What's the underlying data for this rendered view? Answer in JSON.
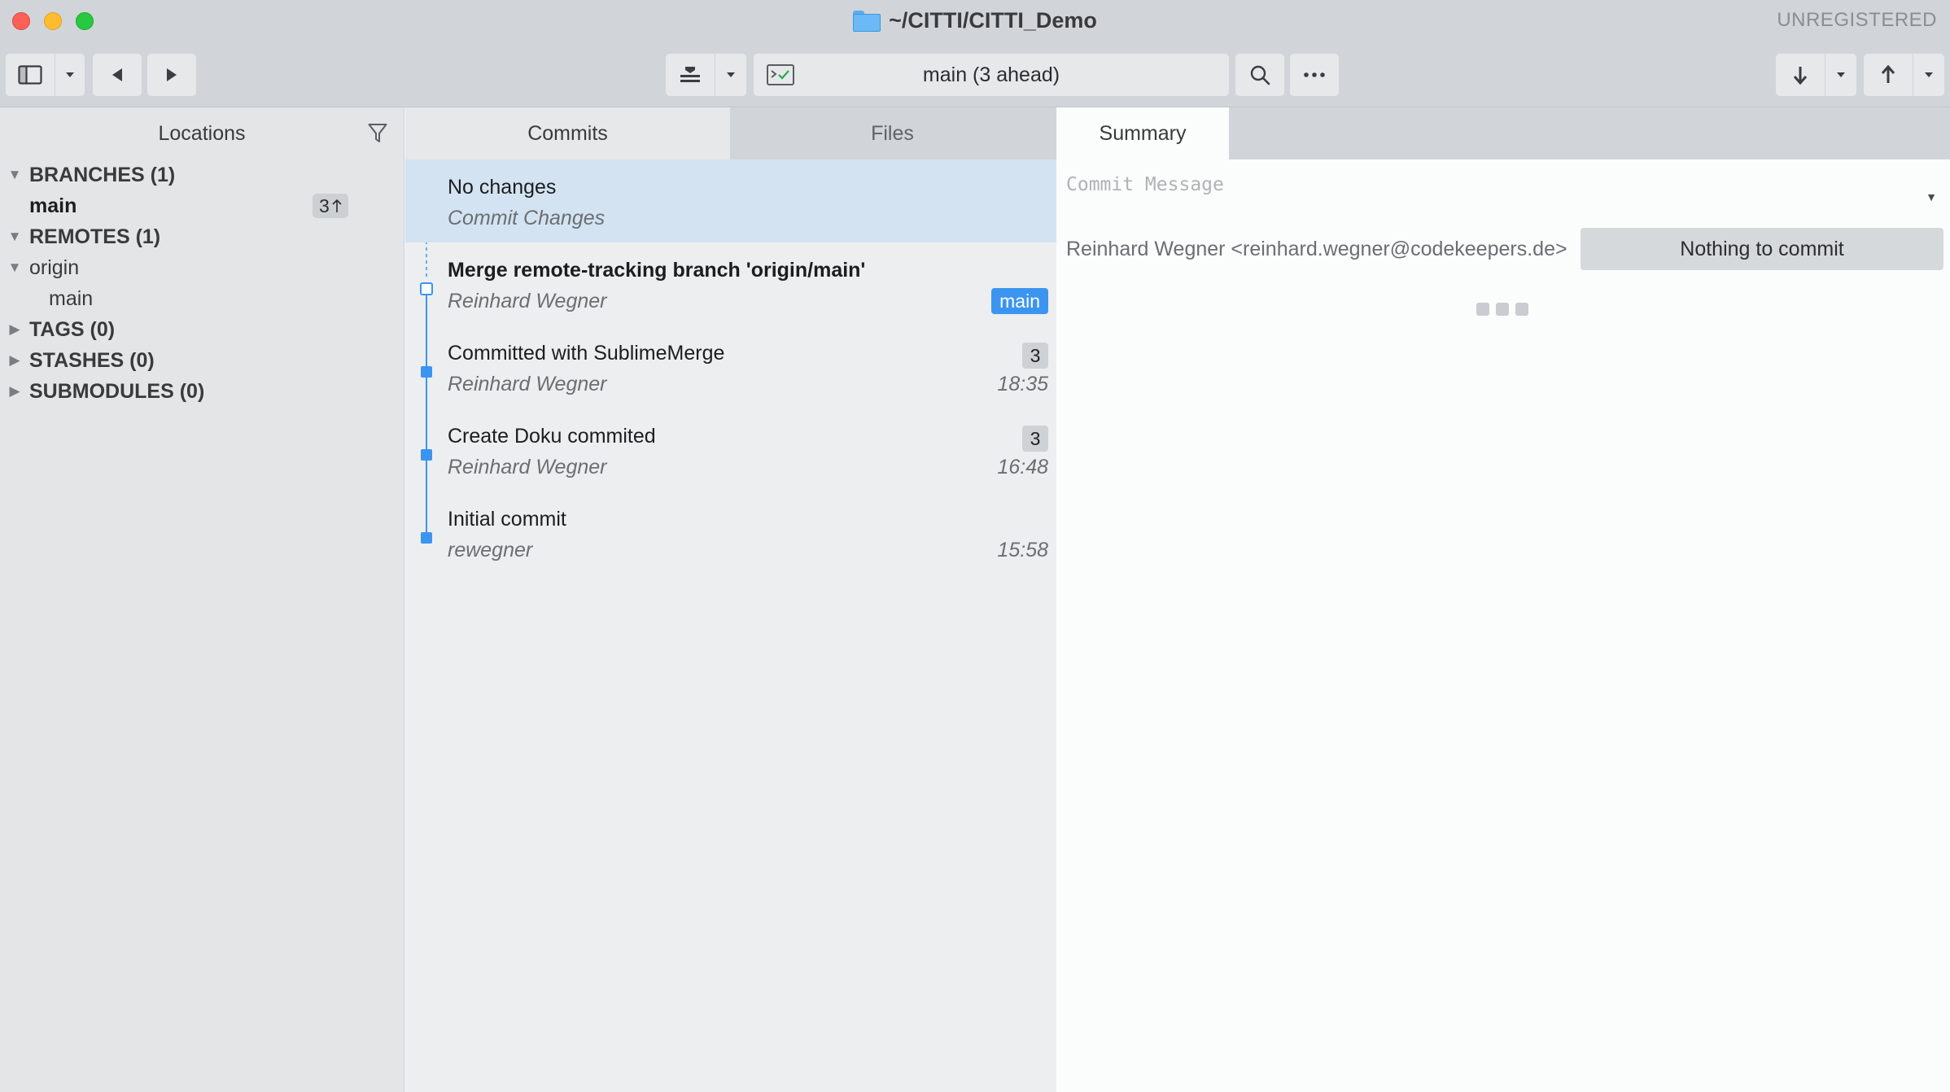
{
  "window": {
    "title": "~/CITTI/CITTI_Demo",
    "license_status": "UNREGISTERED"
  },
  "toolbar": {
    "branch_status": "main (3 ahead)"
  },
  "sidebar": {
    "header": "Locations",
    "sections": {
      "branches": "BRANCHES (1)",
      "branch_main": "main",
      "branch_main_ahead": "3",
      "remotes": "REMOTES (1)",
      "remote_origin": "origin",
      "remote_origin_main": "main",
      "tags": "TAGS (0)",
      "stashes": "STASHES (0)",
      "submodules": "SUBMODULES (0)"
    }
  },
  "tabs": {
    "commits": "Commits",
    "files": "Files",
    "summary": "Summary"
  },
  "commits": [
    {
      "title": "No changes",
      "author": "Commit Changes",
      "time": "",
      "count": "",
      "branch": ""
    },
    {
      "title": "Merge remote-tracking branch 'origin/main'",
      "author": "Reinhard Wegner",
      "time": "",
      "count": "",
      "branch": "main"
    },
    {
      "title": "Committed with SublimeMerge",
      "author": "Reinhard Wegner",
      "time": "18:35",
      "count": "3",
      "branch": ""
    },
    {
      "title": "Create Doku commited",
      "author": "Reinhard Wegner",
      "time": "16:48",
      "count": "3",
      "branch": ""
    },
    {
      "title": "Initial commit",
      "author": "rewegner",
      "time": "15:58",
      "count": "",
      "branch": ""
    }
  ],
  "summary": {
    "commit_message_placeholder": "Commit Message",
    "author": "Reinhard Wegner <reinhard.wegner@codekeepers.de>",
    "commit_button": "Nothing to commit"
  },
  "colors": {
    "accent": "#3b95f0",
    "selected_row": "#d3e3f2"
  }
}
